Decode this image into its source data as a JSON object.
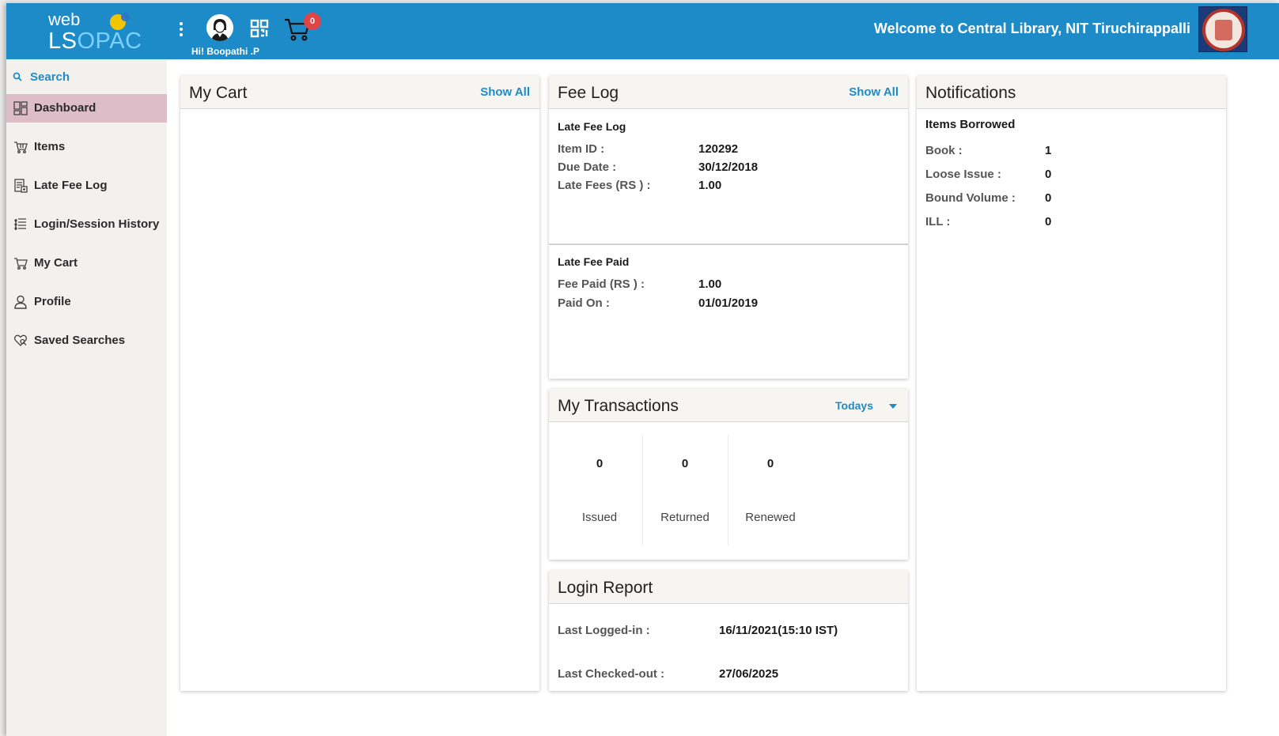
{
  "header": {
    "logo_web": "web",
    "logo_ls": "LS",
    "logo_opac": "OPAC",
    "greeting": "Hi!  Boopathi .P",
    "cart_count": "0",
    "welcome": "Welcome to Central Library, NIT Tiruchirappalli",
    "brand_color": "#1e8bc9"
  },
  "sidebar": {
    "search_label": "Search",
    "items": [
      {
        "label": "Dashboard",
        "icon": "dashboard-icon",
        "active": true
      },
      {
        "label": "Items",
        "icon": "cart-icon"
      },
      {
        "label": "Late Fee Log",
        "icon": "fee-log-icon"
      },
      {
        "label": "Login/Session History",
        "icon": "history-icon"
      },
      {
        "label": "My Cart",
        "icon": "cart-icon"
      },
      {
        "label": "Profile",
        "icon": "user-icon"
      },
      {
        "label": "Saved Searches",
        "icon": "heart-search-icon"
      }
    ]
  },
  "my_cart": {
    "title": "My Cart",
    "show_all": "Show All"
  },
  "fee_log": {
    "title": "Fee Log",
    "show_all": "Show All",
    "late_fee_log": {
      "title": "Late Fee Log",
      "rows": [
        {
          "label": "Item ID :",
          "value": "120292"
        },
        {
          "label": "Due Date :",
          "value": "30/12/2018"
        },
        {
          "label": "Late Fees (RS ) :",
          "value": "1.00"
        }
      ]
    },
    "late_fee_paid": {
      "title": "Late Fee Paid",
      "rows": [
        {
          "label": "Fee Paid (RS ) :",
          "value": "1.00"
        },
        {
          "label": "Paid On :",
          "value": "01/01/2019"
        }
      ]
    }
  },
  "transactions": {
    "title": "My Transactions",
    "filter": "Todays",
    "stats": [
      {
        "count": "0",
        "label": "Issued"
      },
      {
        "count": "0",
        "label": "Returned"
      },
      {
        "count": "0",
        "label": "Renewed"
      }
    ]
  },
  "login_report": {
    "title": "Login Report",
    "rows": [
      {
        "label": "Last Logged-in :",
        "value": "16/11/2021(15:10 IST)"
      },
      {
        "label": "Last Checked-out :",
        "value": "27/06/2025"
      }
    ]
  },
  "notifications": {
    "title": "Notifications",
    "subtitle": "Items Borrowed",
    "rows": [
      {
        "label": "Book :",
        "value": "1"
      },
      {
        "label": "Loose Issue :",
        "value": "0"
      },
      {
        "label": "Bound Volume :",
        "value": "0"
      },
      {
        "label": "ILL :",
        "value": "0"
      }
    ]
  }
}
